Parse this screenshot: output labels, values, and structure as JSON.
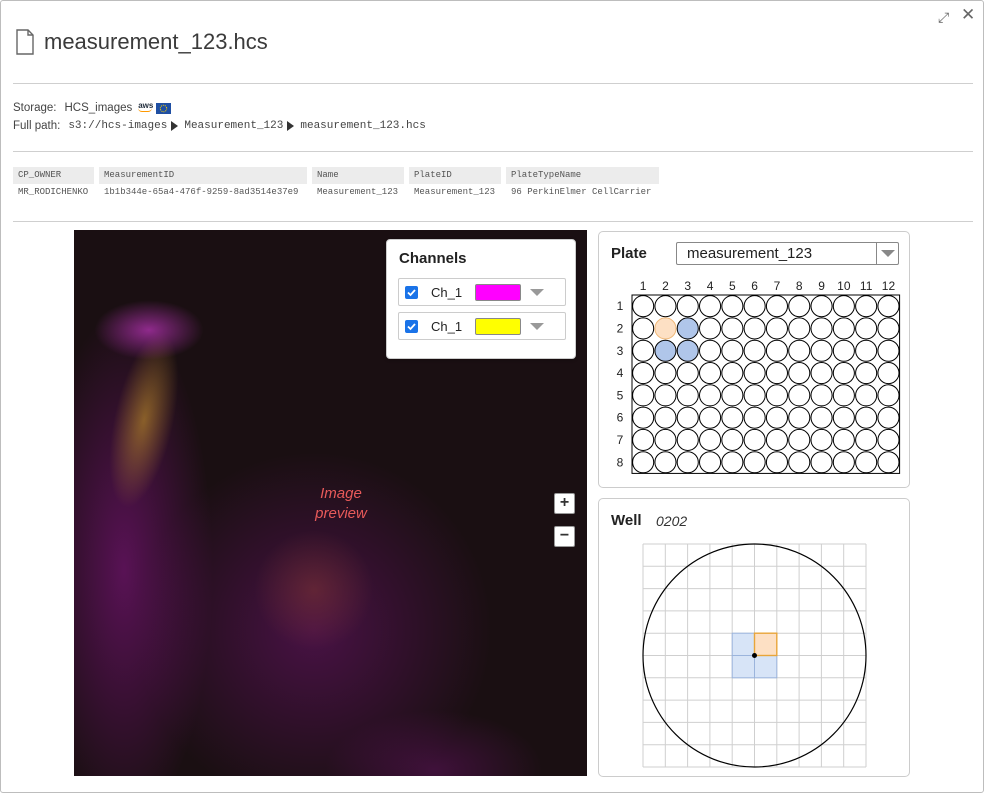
{
  "window": {
    "title": "measurement_123.hcs",
    "expand_icon": "expand-icon",
    "close_icon": "close-icon"
  },
  "storage": {
    "label": "Storage:",
    "value": "HCS_images",
    "provider_text": "aws"
  },
  "full_path": {
    "label": "Full path:",
    "crumbs": [
      "s3://hcs-images",
      "Measurement_123",
      "measurement_123.hcs"
    ]
  },
  "metadata": {
    "columns": [
      {
        "header": "CP_OWNER",
        "value": "MR_RODICHENKO"
      },
      {
        "header": "MeasurementID",
        "value": "1b1b344e-65a4-476f-9259-8ad3514e37e9"
      },
      {
        "header": "Name",
        "value": "Measurement_123"
      },
      {
        "header": "PlateID",
        "value": "Measurement_123"
      },
      {
        "header": "PlateTypeName",
        "value": "96 PerkinElmer CellCarrier"
      }
    ]
  },
  "preview": {
    "text_line1": "Image",
    "text_line2": "preview",
    "zoom_in": "+",
    "zoom_out": "−",
    "text_color": "#e85a5a"
  },
  "channels": {
    "title": "Channels",
    "items": [
      {
        "label": "Ch_1",
        "checked": true,
        "color": "#ff00ff"
      },
      {
        "label": "Ch_1",
        "checked": true,
        "color": "#ffff00"
      }
    ]
  },
  "plate": {
    "title": "Plate",
    "selected": "measurement_123",
    "columns": [
      "1",
      "2",
      "3",
      "4",
      "5",
      "6",
      "7",
      "8",
      "9",
      "10",
      "11",
      "12"
    ],
    "rows": [
      "1",
      "2",
      "3",
      "4",
      "5",
      "6",
      "7",
      "8"
    ],
    "selected_well": {
      "row": 2,
      "col": 2
    },
    "highlighted_wells": [
      {
        "row": 2,
        "col": 3
      },
      {
        "row": 3,
        "col": 2
      },
      {
        "row": 3,
        "col": 3
      }
    ],
    "selected_color": "#fde0c4",
    "selected_border": "#f0b878",
    "highlight_color": "#b0c6ea"
  },
  "well": {
    "title": "Well",
    "id": "0202",
    "grid_size": 10,
    "fields": [
      {
        "row": 4,
        "col": 5,
        "state": "selected"
      },
      {
        "row": 4,
        "col": 4,
        "state": "highlighted"
      },
      {
        "row": 5,
        "col": 4,
        "state": "highlighted"
      },
      {
        "row": 5,
        "col": 5,
        "state": "highlighted"
      }
    ],
    "selected_fill": "#fde0c4",
    "selected_stroke": "#e8a53a",
    "highlight_fill": "#d7e4f7",
    "highlight_stroke": "#9bb4dc"
  }
}
